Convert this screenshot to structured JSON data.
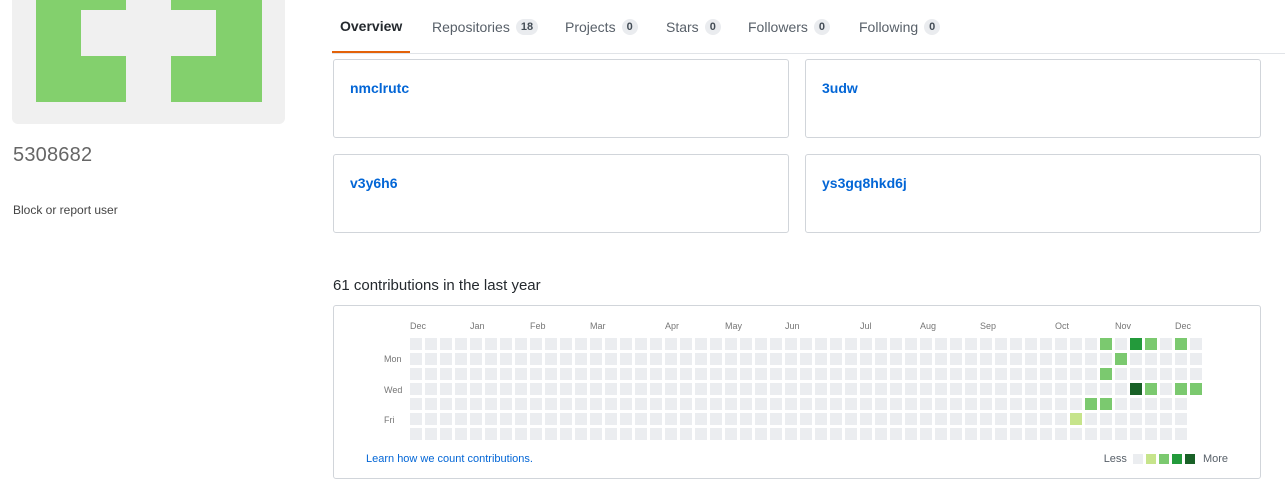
{
  "profile": {
    "username": "5308682",
    "block_link": "Block or report user"
  },
  "tabs": [
    {
      "label": "Overview",
      "count": null,
      "selected": true
    },
    {
      "label": "Repositories",
      "count": "18"
    },
    {
      "label": "Projects",
      "count": "0"
    },
    {
      "label": "Stars",
      "count": "0"
    },
    {
      "label": "Followers",
      "count": "0"
    },
    {
      "label": "Following",
      "count": "0"
    }
  ],
  "pinned": [
    {
      "name": "nmclrutc"
    },
    {
      "name": "3udw"
    },
    {
      "name": "v3y6h6"
    },
    {
      "name": "ys3gq8hkd6j"
    }
  ],
  "contributions": {
    "title": "61 contributions in the last year",
    "months": [
      "Dec",
      "Jan",
      "Feb",
      "Mar",
      "Apr",
      "May",
      "Jun",
      "Jul",
      "Aug",
      "Sep",
      "Oct",
      "Nov",
      "Dec"
    ],
    "weekdays": [
      "Mon",
      "Wed",
      "Fri"
    ],
    "learn_link": "Learn how we count contributions.",
    "legend_less": "Less",
    "legend_more": "More",
    "colors": [
      "#ebedf0",
      "#c6e48b",
      "#7bc96f",
      "#239a3b",
      "#196127"
    ],
    "weeks": 53,
    "last_week_days": 4,
    "active_cells": [
      {
        "week": 44,
        "day": 5,
        "level": 1
      },
      {
        "week": 45,
        "day": 4,
        "level": 2
      },
      {
        "week": 46,
        "day": 0,
        "level": 2
      },
      {
        "week": 46,
        "day": 2,
        "level": 2
      },
      {
        "week": 46,
        "day": 4,
        "level": 2
      },
      {
        "week": 47,
        "day": 1,
        "level": 2
      },
      {
        "week": 48,
        "day": 0,
        "level": 3
      },
      {
        "week": 48,
        "day": 3,
        "level": 4
      },
      {
        "week": 49,
        "day": 0,
        "level": 2
      },
      {
        "week": 49,
        "day": 3,
        "level": 2
      },
      {
        "week": 51,
        "day": 0,
        "level": 2
      },
      {
        "week": 51,
        "day": 3,
        "level": 2
      },
      {
        "week": 52,
        "day": 3,
        "level": 2
      }
    ]
  }
}
